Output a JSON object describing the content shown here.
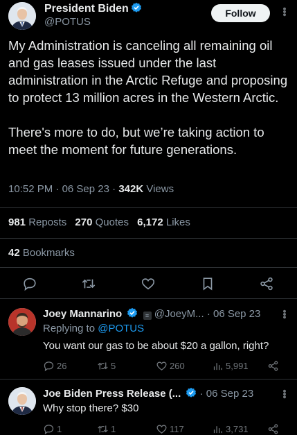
{
  "author": {
    "name": "President Biden",
    "handle": "@POTUS",
    "verified": true,
    "follow_label": "Follow"
  },
  "tweet": {
    "text": "My Administration is canceling all remaining oil and gas leases issued under the last administration in the Arctic Refuge and proposing to protect 13 million acres in the Western Arctic.\n\nThere's more to do, but we’re taking action to meet the moment for future generations.",
    "time": "10:52 PM",
    "date": "06 Sep 23",
    "views_count": "342K",
    "views_label": "Views",
    "sep": "·"
  },
  "stats": {
    "reposts_count": "981",
    "reposts_label": "Reposts",
    "quotes_count": "270",
    "quotes_label": "Quotes",
    "likes_count": "6,172",
    "likes_label": "Likes",
    "bookmarks_count": "42",
    "bookmarks_label": "Bookmarks"
  },
  "actions": [
    "reply-icon",
    "repost-icon",
    "like-icon",
    "bookmark-icon",
    "share-icon"
  ],
  "replies": [
    {
      "name": "Joey Mannarino",
      "handle": "@JoeyM...",
      "date": "· 06 Sep 23",
      "replying_prefix": "Replying to",
      "replying_to": "@POTUS",
      "text": "You want our gas to be about $20 a gallon, right?",
      "replies": "26",
      "reposts": "5",
      "likes": "260",
      "views": "5,991"
    },
    {
      "name": "Joe Biden Press Release (...",
      "date": "· 06 Sep 23",
      "text": "Why stop there? $30",
      "replies": "1",
      "reposts": "1",
      "likes": "117",
      "views": "3,731"
    }
  ],
  "colors": {
    "background": "#000000",
    "text": "#e7e9ea",
    "muted": "#8b98a5",
    "link": "#1d9bf0",
    "verified": "#1d9bf0",
    "divider": "#2f3336"
  }
}
